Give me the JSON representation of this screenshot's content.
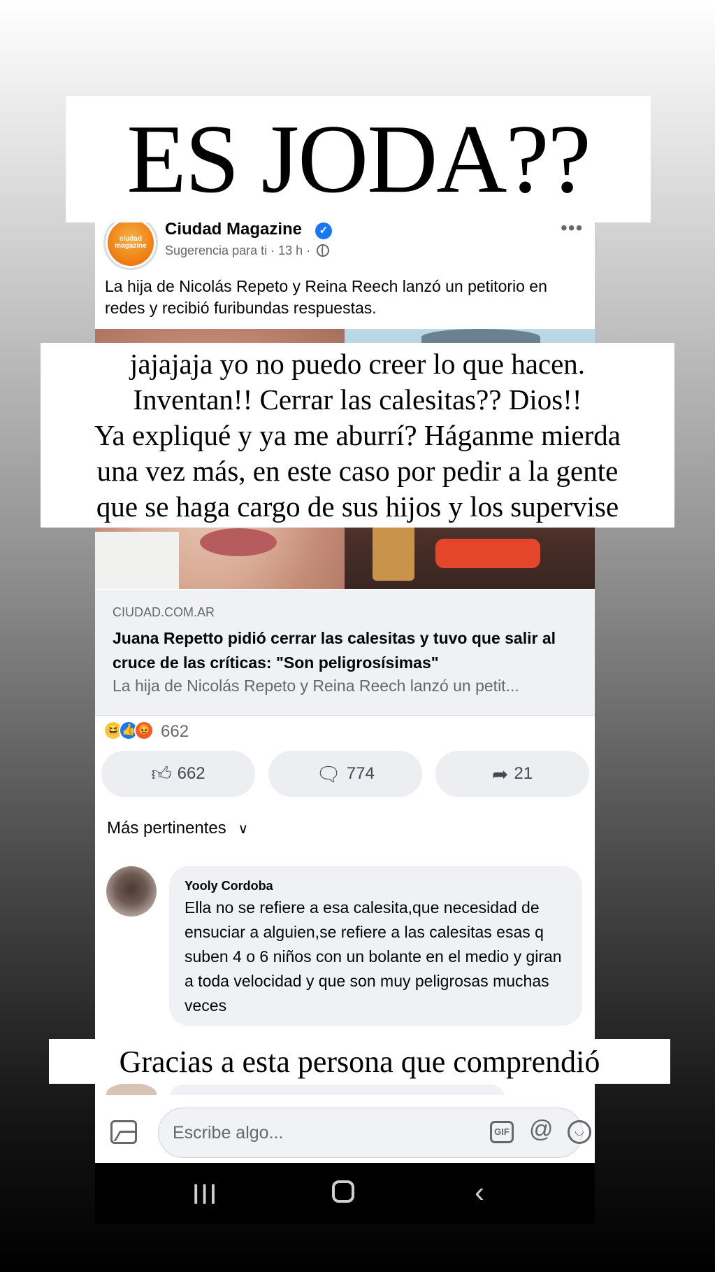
{
  "story": {
    "title": "ES JODA??",
    "middle_lines": [
      "jajajaja yo no puedo creer lo que hacen.",
      "Inventan!! Cerrar las calesitas?? Dios!!",
      "Ya expliqué y ya me aburrí? Háganme mierda",
      "una vez más, en este caso por pedir a la gente",
      "que se haga cargo de sus hijos y los supervise"
    ],
    "bottom": "Gracias a esta persona que comprendió"
  },
  "post": {
    "page_avatar_text": "ciudad magazine",
    "page_name": "Ciudad Magazine",
    "verified_mark": "✓",
    "meta": "Sugerencia para ti · 13 h ·",
    "more": "•••",
    "text": "La hija de Nicolás Repeto y Reina Reech lanzó un petitorio en redes y recibió furibundas respuestas."
  },
  "link": {
    "domain": "CIUDAD.COM.AR",
    "title": "Juana Repetto pidió cerrar las calesitas y tuvo que salir al cruce de las críticas: \"Son peligrosísimas\"",
    "description": "La hija de Nicolás Repeto y Reina Reech lanzó un petit..."
  },
  "reactions": {
    "icons": [
      "haha",
      "like",
      "angry"
    ],
    "count": "662"
  },
  "actions": {
    "like": "662",
    "comment": "774",
    "share": "21"
  },
  "comments": {
    "sort_label": "Más pertinentes",
    "items": [
      {
        "author": "Yooly Cordoba",
        "text": "Ella no se refiere a esa calesita,que necesidad de ensuciar a alguien,se refiere a las calesitas esas q suben 4 o 6 niños con un bolante en el medio y giran a toda velocidad y que son muy peligrosas muchas veces"
      }
    ]
  },
  "composer": {
    "placeholder": "Escribe algo...",
    "gif_label": "GIF"
  },
  "colors": {
    "facebook_blue": "#1877f2",
    "bubble_bg": "#eff1f4",
    "secondary_text": "#65676b"
  }
}
